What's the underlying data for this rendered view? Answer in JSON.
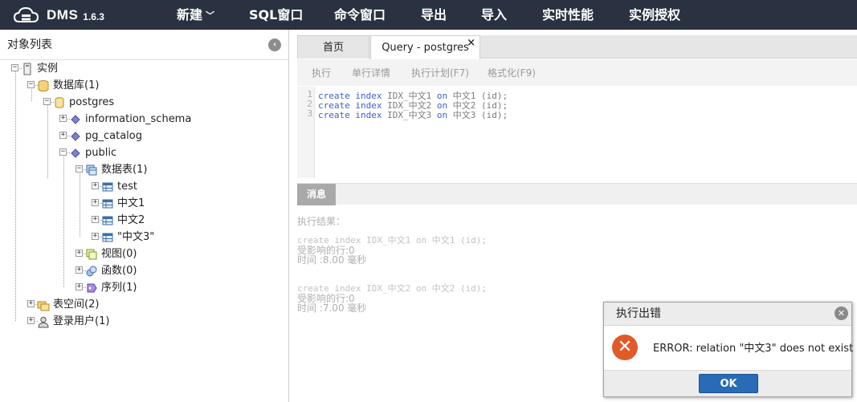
{
  "app": {
    "name": "DMS",
    "version": "1.6.3"
  },
  "nav": [
    {
      "label": "新建",
      "has_dropdown": true
    },
    {
      "label": "SQL窗口"
    },
    {
      "label": "命令窗口"
    },
    {
      "label": "导出"
    },
    {
      "label": "导入"
    },
    {
      "label": "实时性能"
    },
    {
      "label": "实例授权"
    }
  ],
  "sidebar": {
    "title": "对象列表",
    "tree": {
      "instance": "实例",
      "databases": "数据库(1)",
      "database": "postgres",
      "schemas": [
        "information_schema",
        "pg_catalog",
        "public"
      ],
      "tables_group": "数据表(1)",
      "tables": [
        "test",
        "中文1",
        "中文2",
        "\"中文3\""
      ],
      "views": "视图(0)",
      "functions": "函数(0)",
      "sequences": "序列(1)",
      "tablespaces": "表空间(2)",
      "login_users": "登录用户(1)"
    }
  },
  "tabs": [
    {
      "label": "首页",
      "active": false
    },
    {
      "label": "Query - postgres",
      "active": true,
      "close": "×"
    }
  ],
  "toolbar": {
    "execute": "执行",
    "single_detail": "单行详情",
    "explain": "执行计划(F7)",
    "format": "格式化(F9)"
  },
  "editor": {
    "lines": [
      {
        "num": "1",
        "kw1": "create",
        "kw2": "index",
        "name": "IDX_中文1",
        "kw3": "on",
        "rest": "中文1 (id);"
      },
      {
        "num": "2",
        "kw1": "create",
        "kw2": "index",
        "name": "IDX_中文2",
        "kw3": "on",
        "rest": "中文2 (id);"
      },
      {
        "num": "3",
        "kw1": "create",
        "kw2": "index",
        "name": "IDX_中文3",
        "kw3": "on",
        "rest": "中文3 (id);"
      }
    ]
  },
  "messages": {
    "tab": "消息",
    "result_title": "执行结果：",
    "blocks": [
      {
        "sql": "create index IDX_中文1 on 中文1 (id);",
        "affected": "受影响的行:0",
        "time": "时间 :8.00 毫秒"
      },
      {
        "sql": "create index IDX_中文2 on 中文2 (id);",
        "affected": "受影响的行:0",
        "time": "时间 :7.00 毫秒"
      }
    ]
  },
  "dialog": {
    "title": "执行出错",
    "message": "ERROR: relation \"中文3\" does not exist",
    "ok": "OK"
  },
  "colors": {
    "topbar": "#2a3140",
    "keyword": "#3b5fd1",
    "error_icon": "#e05a2a",
    "ok_button": "#2a6bb8"
  }
}
